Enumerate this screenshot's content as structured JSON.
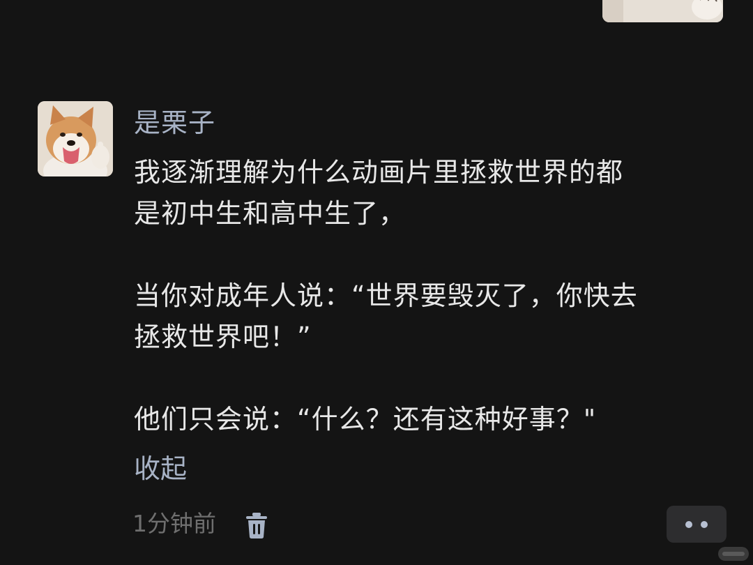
{
  "comment": {
    "username": "是栗子",
    "paragraphs": [
      "我逐渐理解为什么动画片里拯救世界的都\n是初中生和高中生了，",
      "当你对成年人说：“世界要毁灭了，你快去\n拯救世界吧！”",
      "他们只会说：“什么？还有这种好事？\""
    ],
    "collapse_label": "收起",
    "timestamp": "1分钟前"
  },
  "icons": {
    "avatar": "shiba-dog-avatar",
    "delete": "trash-icon",
    "more": "more-dots-icon"
  },
  "colors": {
    "background": "#141414",
    "username": "#a8b3c6",
    "text": "#e8e8e8",
    "timestamp": "#6f6f6f",
    "more_button": "#2d2d2f"
  }
}
